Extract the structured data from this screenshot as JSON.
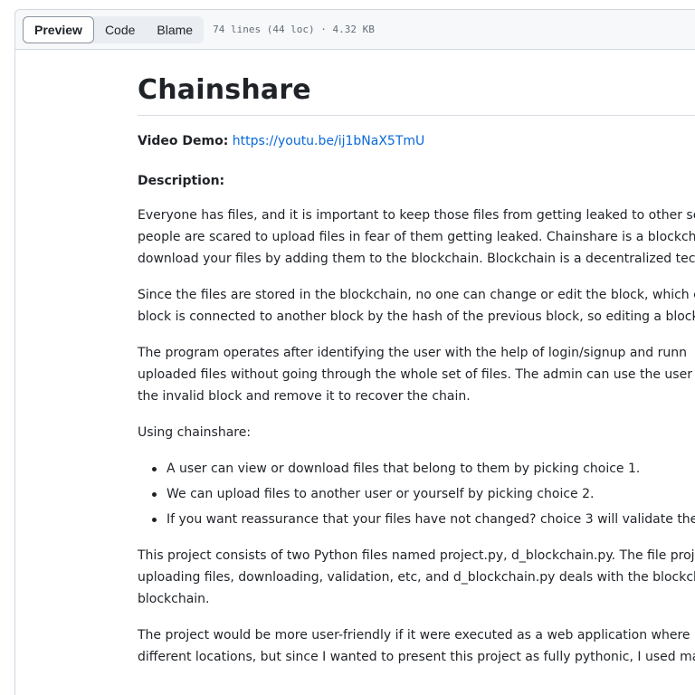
{
  "toolbar": {
    "preview_label": "Preview",
    "code_label": "Code",
    "blame_label": "Blame",
    "file_info": "74 lines (44 loc) · 4.32 KB"
  },
  "readme": {
    "title": "Chainshare",
    "video_demo_label": "Video Demo:",
    "video_demo_link": "https://youtu.be/ij1bNaX5TmU",
    "description_heading": "Description:",
    "para1": [
      "Everyone has files, and it is important to keep those files from getting leaked to other se",
      "people are scared to upload files in fear of them getting leaked. Chainshare is a blockch",
      "download your files by adding them to the blockchain. Blockchain is a decentralized tec"
    ],
    "para2": [
      "Since the files are stored in the blockchain, no one can change or edit the block, which c",
      "block is connected to another block by the hash of the previous block, so editing a block"
    ],
    "para3": [
      "The program operates after identifying the user with the help of login/signup and runn",
      "uploaded files without going through the whole set of files. The admin can use the user",
      "the invalid block and remove it to recover the chain."
    ],
    "using_label": "Using chainshare:",
    "bullets": [
      "A user can view or download files that belong to them by picking choice 1.",
      "We can upload files to another user or yourself by picking choice 2.",
      "If you want reassurance that your files have not changed? choice 3 will validate the"
    ],
    "para4": [
      "This project consists of two Python files named project.py, d_blockchain.py. The file proj",
      "uploading files, downloading, validation, etc, and d_blockchain.py deals with the blockch",
      "blockchain."
    ],
    "para5": [
      "The project would be more user-friendly if it were executed as a web application where",
      "different locations, but since I wanted to present this project as fully pythonic, I used ma"
    ]
  }
}
